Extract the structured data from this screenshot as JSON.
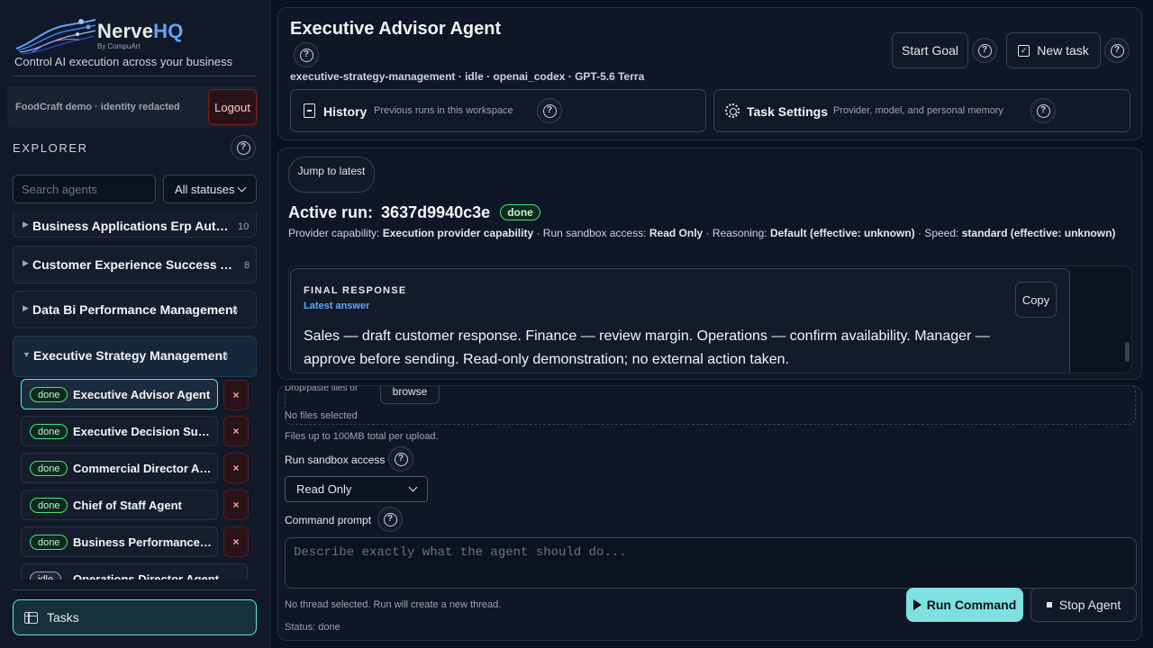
{
  "brand": {
    "name_main": "Nerve",
    "name_accent": "HQ",
    "sub": "By CompuArt",
    "tagline": "Control AI execution across your business"
  },
  "account": {
    "label": "FoodCraft demo · identity redacted",
    "logout_label": "Logout"
  },
  "explorer": {
    "title": "EXPLORER",
    "search_placeholder": "Search agents",
    "status_filter": "All statuses",
    "groups": [
      {
        "name": "Business Applications Erp Auto...",
        "count": "10",
        "expanded": false
      },
      {
        "name": "Customer Experience Success Af...",
        "count": "8",
        "expanded": false
      },
      {
        "name": "Data Bi Performance Management",
        "count": "8",
        "expanded": false
      },
      {
        "name": "Executive Strategy Management",
        "count": "8",
        "expanded": true
      }
    ],
    "agents": [
      {
        "status": "done",
        "name": "Executive Advisor Agent",
        "active": true
      },
      {
        "status": "done",
        "name": "Executive Decision Sup..."
      },
      {
        "status": "done",
        "name": "Commercial Director Ag..."
      },
      {
        "status": "done",
        "name": "Chief of Staff Agent"
      },
      {
        "status": "done",
        "name": "Business Performance ..."
      },
      {
        "status": "idle",
        "name": "Operations Director Agent"
      }
    ],
    "delete_glyph": "×"
  },
  "tasks_label": "Tasks",
  "header": {
    "title": "Executive Advisor Agent",
    "meta": "executive-strategy-management · idle · openai_codex · GPT-5.6 Terra",
    "start_goal_label": "Start Goal",
    "new_task_label": "New task",
    "history": {
      "title": "History",
      "desc": "Previous runs in this workspace"
    },
    "task_settings": {
      "title": "Task Settings",
      "desc": "Provider, model, and personal memory"
    }
  },
  "run": {
    "jump_label": "Jump to latest",
    "title_prefix": "Active run:",
    "run_id": "3637d9940c3e",
    "status": "done",
    "info": {
      "cap_label": "Provider capability:",
      "cap_value": "Execution provider capability",
      "sandbox_label": "Run sandbox access:",
      "sandbox_value": "Read Only",
      "reasoning_label": "Reasoning:",
      "reasoning_value": "Default (effective: unknown)",
      "speed_label": "Speed:",
      "speed_value": "standard (effective: unknown)"
    },
    "response": {
      "label": "FINAL RESPONSE",
      "sub": "Latest answer",
      "copy_label": "Copy",
      "text": "Sales — draft customer response. Finance — review margin. Operations — confirm availability. Manager — approve before sending. Read-only demonstration; no external action taken."
    }
  },
  "command": {
    "drop_text": "Drop/paste files or",
    "browse_label": "browse",
    "no_files": "No files selected",
    "upload_note": "Files up to 100MB total per upload.",
    "sandbox_label": "Run sandbox access",
    "sandbox_value": "Read Only",
    "prompt_label": "Command prompt",
    "prompt_placeholder": "Describe exactly what the agent should do...",
    "thread_note": "No thread selected. Run will create a new thread.",
    "status_text": "Status: done",
    "run_label": "Run Command",
    "stop_label": "Stop Agent"
  },
  "colors": {
    "accent_teal": "#5eead4",
    "run_button": "#7ee0e0",
    "done_green": "#4ade80",
    "link_blue": "#60a5fa",
    "danger": "#7f1d1d"
  }
}
